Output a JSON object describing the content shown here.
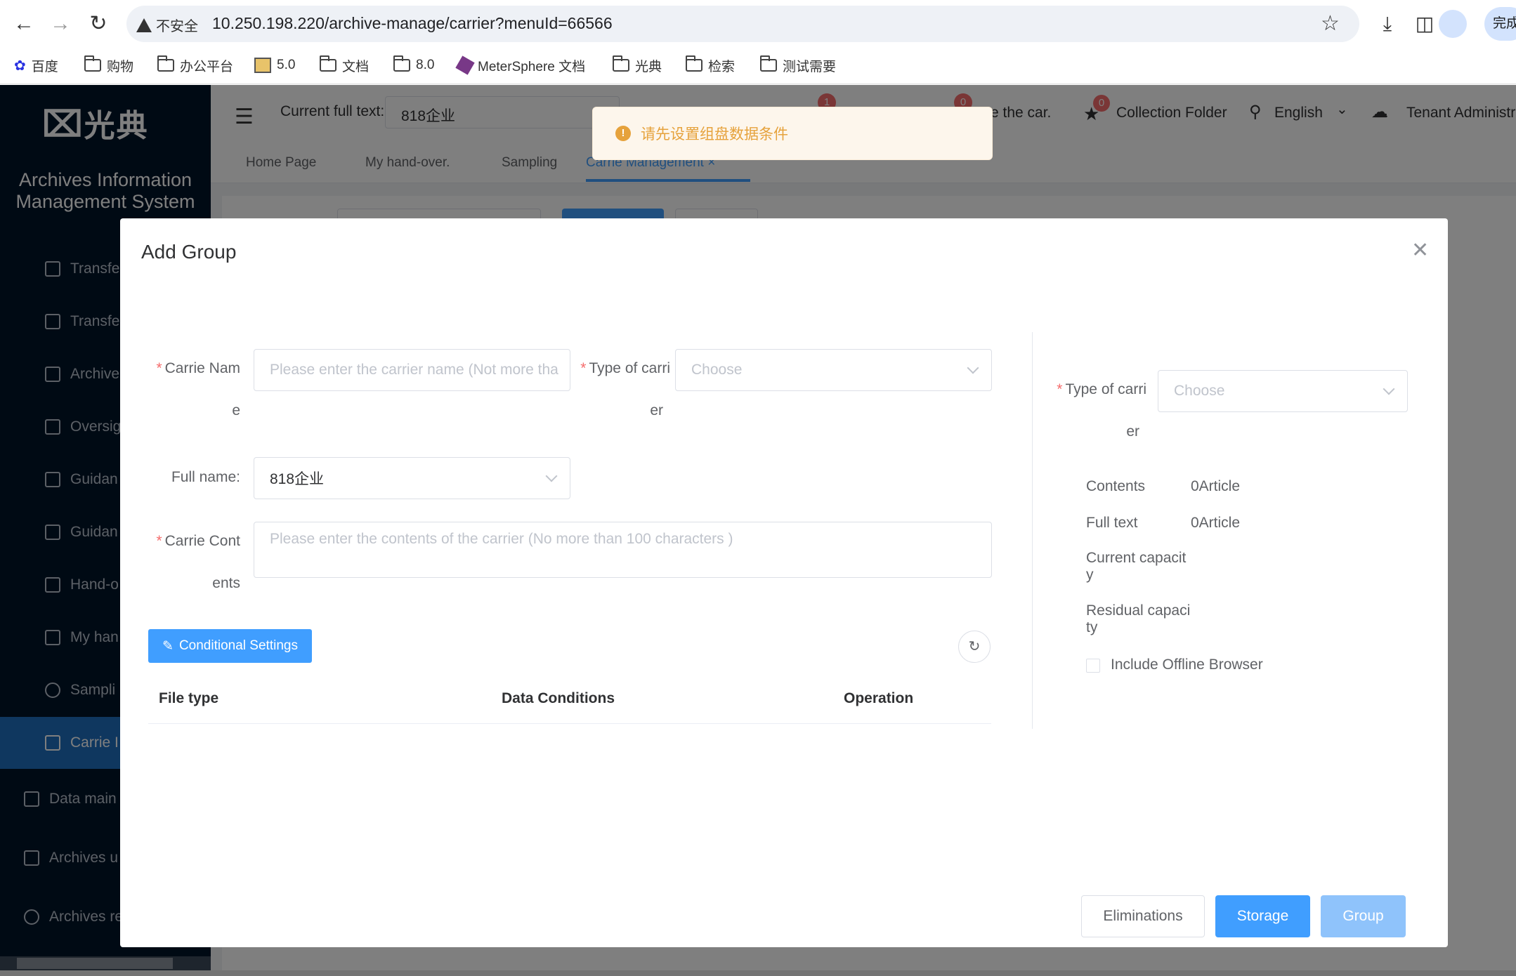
{
  "browser": {
    "security_label": "不安全",
    "url": "10.250.198.220/archive-manage/carrier?menuId=66566",
    "profile_pill": "完成"
  },
  "bookmarks": [
    {
      "label": "百度",
      "icon": "baidu-icon"
    },
    {
      "label": "购物",
      "icon": "folder-icon"
    },
    {
      "label": "办公平台",
      "icon": "folder-icon"
    },
    {
      "label": "5.0",
      "icon": "image-icon"
    },
    {
      "label": "文档",
      "icon": "folder-icon"
    },
    {
      "label": "8.0",
      "icon": "folder-icon"
    },
    {
      "label": "MeterSphere 文档",
      "icon": "metersphere-icon"
    },
    {
      "label": "光典",
      "icon": "folder-icon"
    },
    {
      "label": "检索",
      "icon": "folder-icon"
    },
    {
      "label": "测试需要",
      "icon": "folder-icon"
    }
  ],
  "app": {
    "logo_text": "光典",
    "system_name_line1": "Archives Information",
    "system_name_line2": "Management System",
    "header": {
      "current_full_text_label": "Current full text:",
      "current_full_text_value": "818企业",
      "badge_1": "1",
      "badge_2": "0",
      "car_text": "e the car.",
      "collection_badge": "0",
      "collection_label": "Collection Folder",
      "language": "English",
      "tenant": "Tenant Administr"
    },
    "tabs": [
      "Home Page",
      "My hand-over.",
      "Sampling",
      "Carrie Management"
    ],
    "sidebar": [
      {
        "label": "Transfe",
        "icon": "list-icon"
      },
      {
        "label": "Transfe",
        "icon": "list-icon"
      },
      {
        "label": "Archive",
        "icon": "archive-icon"
      },
      {
        "label": "Oversig",
        "icon": "hand-icon"
      },
      {
        "label": "Guidan",
        "icon": "message-icon"
      },
      {
        "label": "Guidan",
        "icon": "message-icon"
      },
      {
        "label": "Hand-o",
        "icon": "crop-icon"
      },
      {
        "label": "My han",
        "icon": "mail-icon"
      },
      {
        "label": "Sampli",
        "icon": "target-icon"
      },
      {
        "label": "Carrie I",
        "icon": "chip-icon"
      },
      {
        "label": "Data main",
        "icon": "building-icon"
      },
      {
        "label": "Archives u",
        "icon": "clipboard-icon"
      },
      {
        "label": "Archives re",
        "icon": "search-icon"
      }
    ]
  },
  "toast": {
    "message": "请先设置组盘数据条件"
  },
  "dialog": {
    "title": "Add Group",
    "carrier_name_label_1": "Carrie Nam",
    "carrier_name_label_2": "e",
    "carrier_name_placeholder": "Please enter the carrier name (Not more tha",
    "type_label_1": "Type of carri",
    "type_label_2": "er",
    "type_placeholder": "Choose",
    "full_name_label": "Full name:",
    "full_name_value": "818企业",
    "contents_label_1": "Carrie Cont",
    "contents_label_2": "ents",
    "contents_placeholder": "Please enter the contents of the carrier (No more than 100 characters )",
    "conditional_settings": "Conditional Settings",
    "table_headers": [
      "File type",
      "Data Conditions",
      "Operation"
    ],
    "right": {
      "type_label_1": "Type of carri",
      "type_label_2": "er",
      "type_placeholder": "Choose",
      "contents_label": "Contents",
      "contents_value": "0Article",
      "full_text_label": "Full text",
      "full_text_value": "0Article",
      "current_capacity_1": "Current capacit",
      "current_capacity_2": "y",
      "residual_capacity_1": "Residual capaci",
      "residual_capacity_2": "ty",
      "include_offline": "Include Offline Browser"
    },
    "buttons": {
      "eliminations": "Eliminations",
      "storage": "Storage",
      "group": "Group"
    }
  }
}
